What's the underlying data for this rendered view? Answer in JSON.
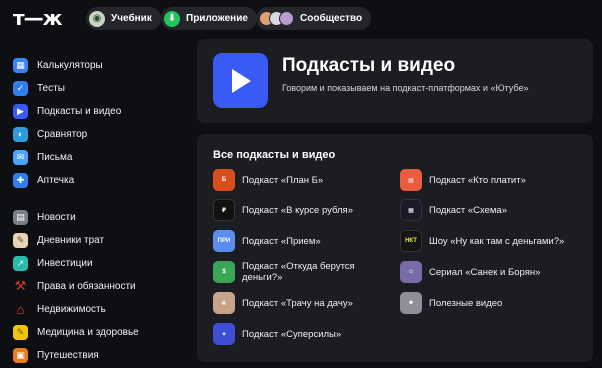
{
  "header": {
    "logo": "т—ж",
    "pills": [
      {
        "label": "Учебник",
        "icon": "tutorial-icon"
      },
      {
        "label": "Приложение",
        "icon": "download-icon"
      },
      {
        "label": "Сообщество",
        "icon": "community-avatars-icon"
      }
    ]
  },
  "sidebar": {
    "items": [
      {
        "label": "Калькуляторы",
        "icon": "calculator-icon",
        "color": "#3b82f6"
      },
      {
        "label": "Тесты",
        "icon": "test-icon",
        "color": "#2f80ed"
      },
      {
        "label": "Подкасты и видео",
        "icon": "podcast-icon",
        "color": "#3a5af5"
      },
      {
        "label": "Сравнятор",
        "icon": "compare-icon",
        "color": "#2d9cdb"
      },
      {
        "label": "Письма",
        "icon": "mail-icon",
        "color": "#4ea3ff"
      },
      {
        "label": "Аптечка",
        "icon": "first-aid-icon",
        "color": "#2f80ed"
      },
      {
        "label": "Новости",
        "icon": "news-icon",
        "color": "#7a7f88"
      },
      {
        "label": "Дневники трат",
        "icon": "diary-icon",
        "color": "#e8d2b8"
      },
      {
        "label": "Инвестиции",
        "icon": "investment-icon",
        "color": "#2bbbad"
      },
      {
        "label": "Права и обязанности",
        "icon": "gavel-icon",
        "color": "#c0392b"
      },
      {
        "label": "Недвижимость",
        "icon": "house-icon",
        "color": "#e74c3c"
      },
      {
        "label": "Медицина и здоровье",
        "icon": "medicine-icon",
        "color": "#f1c40f"
      },
      {
        "label": "Путешествия",
        "icon": "travel-icon",
        "color": "#e67e22"
      }
    ]
  },
  "hero": {
    "title": "Подкасты и видео",
    "subtitle": "Говорим и показываем на подкаст-платформах и «Ютубе»"
  },
  "list": {
    "title": "Все подкасты и видео",
    "left": [
      {
        "label": "Подкаст «План Б»",
        "icon": "plan-b-cover-icon",
        "color": "#d94e1f"
      },
      {
        "label": "Подкаст «В курсе рубля»",
        "icon": "rouble-cover-icon",
        "color": "#111111"
      },
      {
        "label": "Подкаст «Прием»",
        "icon": "priem-cover-icon",
        "color": "#5b8def"
      },
      {
        "label": "Подкаст «Откуда берутся деньги?»",
        "icon": "money-cover-icon",
        "color": "#3aa657"
      },
      {
        "label": "Подкаст «Трачу на дачу»",
        "icon": "dacha-cover-icon",
        "color": "#c9a389"
      },
      {
        "label": "Подкаст «Суперсилы»",
        "icon": "supersila-cover-icon",
        "color": "#3e4fd6"
      }
    ],
    "right": [
      {
        "label": "Подкаст «Кто платит»",
        "icon": "who-pays-cover-icon",
        "color": "#e85c3f"
      },
      {
        "label": "Подкаст «Схема»",
        "icon": "schema-cover-icon",
        "color": "#1a1a2a"
      },
      {
        "label": "Шоу «Ну как там с деньгами?»",
        "icon": "show-cover-icon",
        "color": "#151515"
      },
      {
        "label": "Сериал «Санек и Борян»",
        "icon": "series-cover-icon",
        "color": "#7b6aa8"
      },
      {
        "label": "Полезные видео",
        "icon": "useful-video-cover-icon",
        "color": "#8f8f9a"
      }
    ]
  }
}
